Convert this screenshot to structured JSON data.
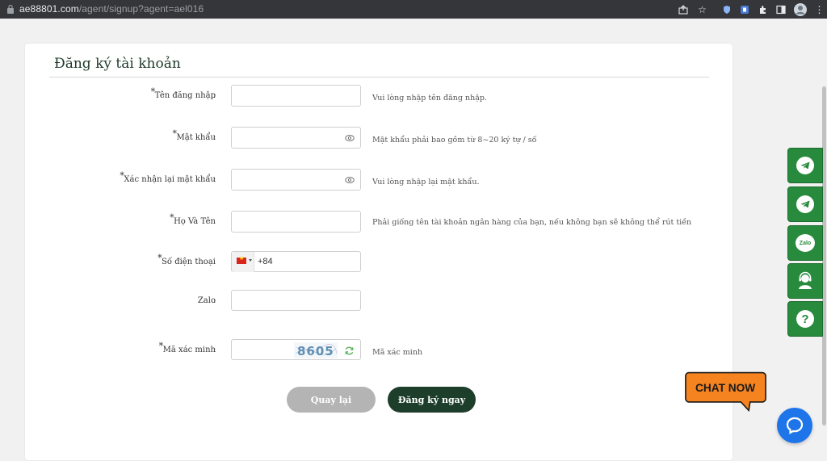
{
  "browser": {
    "url_host": "ae88801.com",
    "url_path": "/agent/signup?agent=ael016"
  },
  "form": {
    "title": "Đăng ký tài khoản",
    "fields": [
      {
        "label": "Tên đăng nhập",
        "required": true,
        "hint": "Vui lòng nhập tên đăng nhập.",
        "value": ""
      },
      {
        "label": "Mật khẩu",
        "required": true,
        "hint": "Mật khẩu phải bao gồm từ 8~20 ký tự / số",
        "value": ""
      },
      {
        "label": "Xác nhận lại mật khẩu",
        "required": true,
        "hint": "Vui lòng nhập lại mật khẩu.",
        "value": ""
      },
      {
        "label": "Họ Và Tên",
        "required": true,
        "hint": "Phải giống tên tài khoản ngân hàng của bạn, nếu không bạn sẽ không thể rút tiền",
        "value": ""
      },
      {
        "label": "Số điện thoại",
        "required": true,
        "hint": "",
        "value": "+84"
      },
      {
        "label": "Zalo",
        "required": false,
        "hint": "",
        "value": ""
      },
      {
        "label": "Mã xác minh",
        "required": true,
        "hint": "Mã xác minh",
        "value": "",
        "captcha": "8605"
      }
    ],
    "colon": ":",
    "star": "*",
    "back_label": "Quay lại",
    "submit_label": "Đăng ký ngay"
  },
  "side_buttons": {
    "zalo_label": "Zalo"
  },
  "chat": {
    "label": "CHAT NOW"
  },
  "colors": {
    "primary": "#1d3e2b",
    "side_green": "#278a3c",
    "chat_orange": "#f5831f",
    "messenger_blue": "#1e74e9"
  }
}
